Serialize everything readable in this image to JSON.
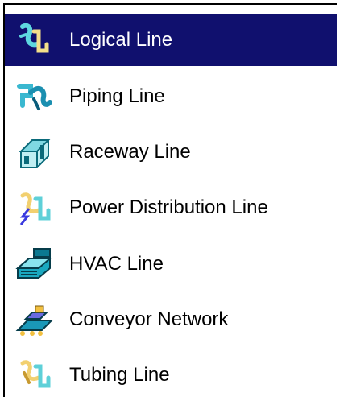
{
  "menu": {
    "items": [
      {
        "label": "Logical Line",
        "icon": "logical-line-icon",
        "selected": true
      },
      {
        "label": "Piping Line",
        "icon": "piping-line-icon",
        "selected": false
      },
      {
        "label": "Raceway Line",
        "icon": "raceway-line-icon",
        "selected": false
      },
      {
        "label": "Power Distribution Line",
        "icon": "power-distribution-line-icon",
        "selected": false
      },
      {
        "label": "HVAC Line",
        "icon": "hvac-line-icon",
        "selected": false
      },
      {
        "label": "Conveyor Network",
        "icon": "conveyor-network-icon",
        "selected": false
      },
      {
        "label": "Tubing Line",
        "icon": "tubing-line-icon",
        "selected": false
      }
    ],
    "colors": {
      "selection_bg": "#10106e",
      "selected_text": "#ffffff",
      "text": "#000000"
    }
  }
}
